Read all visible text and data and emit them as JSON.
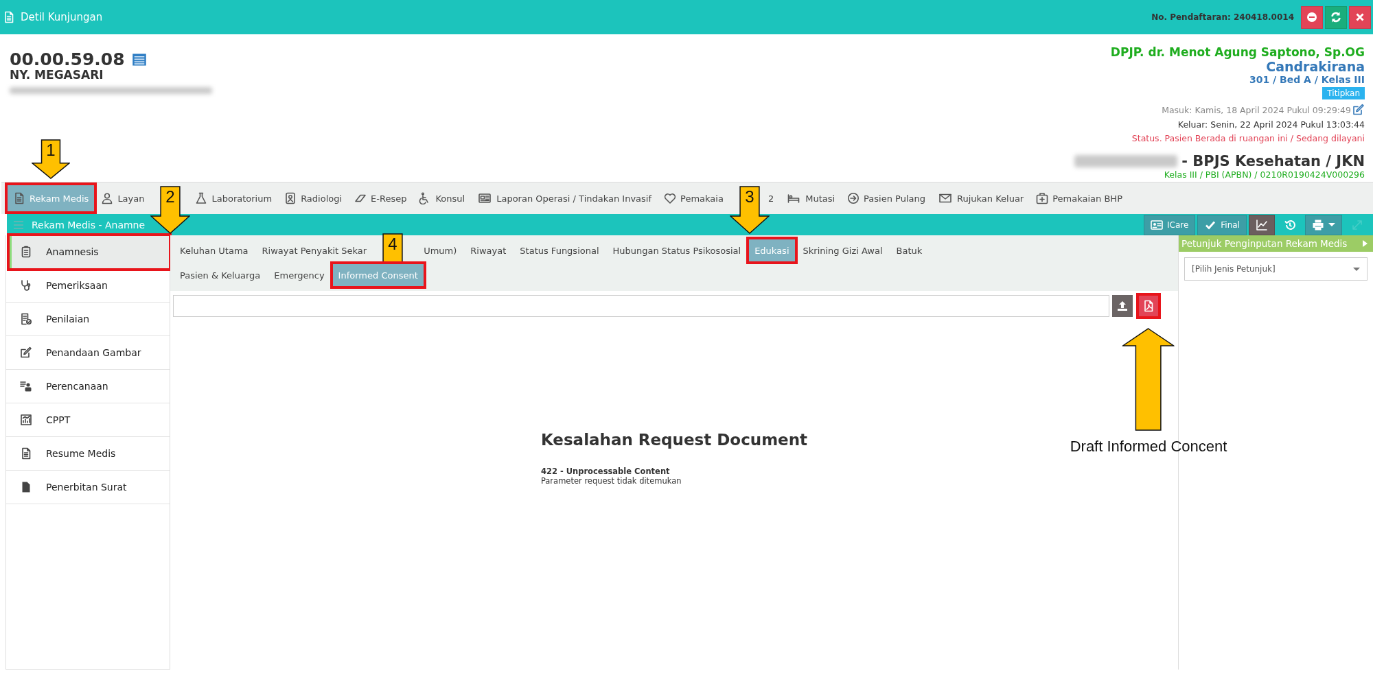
{
  "window": {
    "title": "Detil Kunjungan",
    "registration": "No. Pendaftaran: 240418.0014"
  },
  "window_buttons": [
    {
      "kind": "remove"
    },
    {
      "kind": "refresh"
    },
    {
      "kind": "close"
    }
  ],
  "patient": {
    "record_number": "00.00.59.08",
    "name": "NY. MEGASARI"
  },
  "visit": {
    "doctor": "DPJP. dr. Menot Agung Saptono, Sp.OG",
    "ward": "Candrakirana",
    "room": "301 / Bed A / Kelas III",
    "badge": "Titipkan",
    "admitted": "Masuk: Kamis, 18 April 2024 Pukul 09:29:49",
    "discharged": "Keluar: Senin, 22 April 2024 Pukul 13:03:44",
    "status": "Status. Pasien Berada di ruangan ini / Sedang dilayani",
    "insurance": "- BPJS Kesehatan / JKN",
    "insurance_detail": "Kelas III / PBI (APBN) / 0210R0190424V000296"
  },
  "tabs": [
    {
      "label": "Rekam Medis",
      "selected": true,
      "highlighted": true,
      "arrow_above": "1"
    },
    {
      "label": "Layan",
      "selected": false,
      "highlighted": false,
      "arrow_over": "2"
    },
    {
      "label": "Laboratorium",
      "selected": false,
      "highlighted": false
    },
    {
      "label": "Radiologi",
      "selected": false,
      "highlighted": false
    },
    {
      "label": "E-Resep",
      "selected": false,
      "highlighted": false
    },
    {
      "label": "Konsul",
      "selected": false,
      "highlighted": false
    },
    {
      "label": "Laporan Operasi / Tindakan Invasif",
      "selected": false,
      "highlighted": false
    },
    {
      "label": "Pemakaia",
      "selected": false,
      "highlighted": false,
      "arrow_over": "3",
      "tail": "2"
    },
    {
      "label": "Mutasi",
      "selected": false,
      "highlighted": false
    },
    {
      "label": "Pasien Pulang",
      "selected": false,
      "highlighted": false
    },
    {
      "label": "Rujukan Keluar",
      "selected": false,
      "highlighted": false
    },
    {
      "label": "Pemakaian BHP",
      "selected": false,
      "highlighted": false
    }
  ],
  "section": {
    "title": "Rekam Medis - Anamne",
    "buttons": [
      {
        "kind": "icare",
        "label": "ICare",
        "disabled": false
      },
      {
        "kind": "final",
        "label": "Final",
        "disabled": false
      },
      {
        "kind": "chart",
        "disabled": false
      },
      {
        "kind": "history",
        "disabled": false
      },
      {
        "kind": "print",
        "disabled": false
      },
      {
        "kind": "expand",
        "disabled": true
      }
    ]
  },
  "sidebar": {
    "items": [
      {
        "label": "Anamnesis",
        "selected": true,
        "highlighted": true
      },
      {
        "label": "Pemeriksaan",
        "selected": false,
        "highlighted": false
      },
      {
        "label": "Penilaian",
        "selected": false,
        "highlighted": false
      },
      {
        "label": "Penandaan Gambar",
        "selected": false,
        "highlighted": false
      },
      {
        "label": "Perencanaan",
        "selected": false,
        "highlighted": false
      },
      {
        "label": "CPPT",
        "selected": false,
        "highlighted": false
      },
      {
        "label": "Resume Medis",
        "selected": false,
        "highlighted": false
      },
      {
        "label": "Penerbitan Surat",
        "selected": false,
        "highlighted": false
      }
    ]
  },
  "subtab_rows": [
    [
      {
        "label": "Keluhan Utama",
        "selected": false,
        "highlighted": false
      },
      {
        "label": "Riwayat Penyakit Sekar",
        "tail": "Umum)",
        "arrow_over": "4",
        "selected": false,
        "highlighted": false
      },
      {
        "label": "Riwayat",
        "selected": false,
        "highlighted": false
      },
      {
        "label": "Status Fungsional",
        "selected": false,
        "highlighted": false
      },
      {
        "label": "Hubungan Status Psikososial",
        "selected": false,
        "highlighted": false
      },
      {
        "label": "Edukasi",
        "selected": true,
        "highlighted": true
      },
      {
        "label": "Skrining Gizi Awal",
        "selected": false,
        "highlighted": false
      },
      {
        "label": "Batuk",
        "selected": false,
        "highlighted": false
      }
    ],
    [
      {
        "label": "Pasien & Keluarga",
        "selected": false,
        "highlighted": false
      },
      {
        "label": "Emergency",
        "selected": false,
        "highlighted": false
      },
      {
        "label": "Informed Consent",
        "selected": true,
        "highlighted": true
      }
    ]
  ],
  "pdf_button": {
    "highlighted": true,
    "annotation": "Draft Informed Concent"
  },
  "document": {
    "error_title": "Kesalahan Request Document",
    "error_code": "422 - Unprocessable Content",
    "error_message": "Parameter request tidak ditemukan"
  },
  "guide_panel": {
    "title": "Petunjuk Penginputan Rekam Medis",
    "select_value": "[Pilih Jenis Petunjuk]"
  }
}
